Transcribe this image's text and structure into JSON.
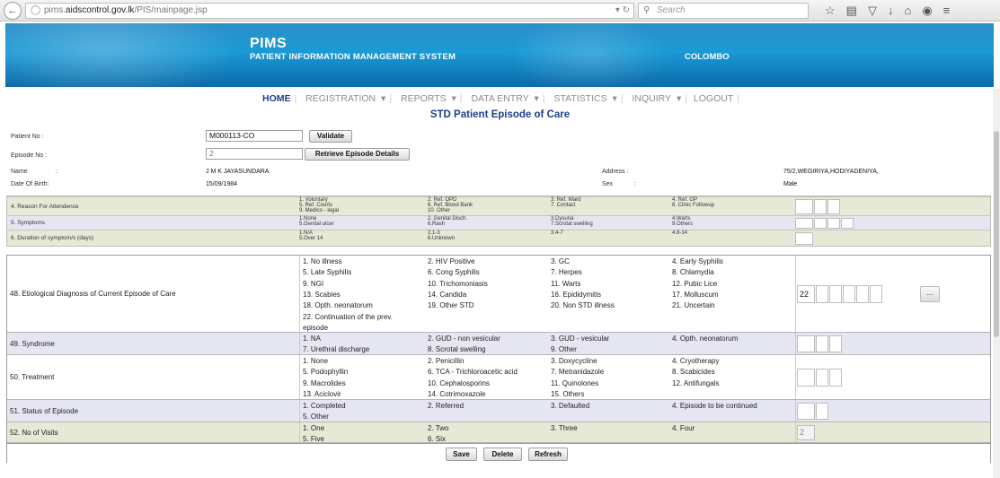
{
  "browser": {
    "url_prefix": "pims.",
    "url_domain": "aidscontrol.gov.lk",
    "url_path": "/PIS/mainpage.jsp",
    "search_placeholder": "Search"
  },
  "header": {
    "app": "PIMS",
    "subtitle": "PATIENT INFORMATION MANAGEMENT SYSTEM",
    "location": "COLOMBO"
  },
  "nav": [
    "HOME",
    "REGISTRATION",
    "REPORTS",
    "DATA ENTRY",
    "STATISTICS",
    "INQUIRY",
    "LOGOUT"
  ],
  "page_title": "STD Patient Episode of Care",
  "form": {
    "patient_no_label": "Patient No :",
    "patient_no": "M000113-CO",
    "validate": "Validate",
    "episode_no_label": "Episode No :",
    "episode_no": "2",
    "retrieve": "Retrieve Episode Details",
    "name_label": "Name",
    "name_colon": ":",
    "name": "J M K JAYASUNDARA",
    "address_label": "Address :",
    "address": "75/2,WEGIRIYA,HODIYADENIYA,",
    "dob_label": "Date Of Birth:",
    "dob": "15/09/1984",
    "sex_label": "Sex",
    "sex_colon": ":",
    "sex": "Male"
  },
  "sec1": [
    {
      "label": "4. Reason For Attendence",
      "opts": [
        "1. Voluntary",
        "2. Ref. OPD",
        "3. Ref. Ward",
        "4. Ref. GP",
        "5. Ref. Courts",
        "6. Ref. Blood Bank",
        "7. Contact",
        "8. Clinic Followup",
        "9. Medico - legal",
        "10. Other"
      ],
      "cols": 4,
      "boxes": 3
    },
    {
      "label": "5. Symptoms",
      "opts": [
        "1.None",
        "2. Genital Disch.",
        "3.Dysuria",
        "4.Warts",
        "5.Genital ulcer",
        "6.Rash",
        "7.Scrotal swelling",
        "9.Others"
      ],
      "cols": 4,
      "boxes": 4
    },
    {
      "label": "6. Duration of symptom/s (days)",
      "opts": [
        "1.N/A",
        "2.1-3",
        "3.4-7",
        "4.8-14",
        "5.Over 14",
        "6.Unknown"
      ],
      "cols": 4,
      "boxes": 1
    }
  ],
  "sec2": [
    {
      "label": "48. Etiological Diagnosis of Current Episode of Care",
      "opts": [
        "1. No illness",
        "2. HIV Positive",
        "3. GC",
        "4. Early Syphilis",
        "5. Late Syphilis",
        "6. Cong Syphilis",
        "7. Herpes",
        "8. Chlamydia",
        "9. NGI",
        "10. Trichomoniasis",
        "11. Warts",
        "12. Pubic Lice",
        "13. Scabies",
        "14. Candida",
        "16. Epididymitis",
        "17. Molluscum",
        "18. Opth. neonatorum",
        "19. Other STD",
        "20. Non STD illness",
        "21. Uncertain",
        "22. Continuation of the prev.",
        "",
        "",
        "",
        "episode",
        "",
        "",
        ""
      ],
      "value": "22",
      "boxes": 6
    },
    {
      "label": "49. Syndrome",
      "opts": [
        "1. NA",
        "2. GUD - non vesicular",
        "3. GUD - vesicular",
        "4. Opth. neonatorum",
        "7. Urethral discharge",
        "8. Scrotal swelling",
        "9. Other",
        ""
      ],
      "boxes": 3
    },
    {
      "label": "50. Treatment",
      "opts": [
        "1. None",
        "2. Penicillin",
        "3. Doxycycline",
        "4. Cryotherapy",
        "5. Podophyllin",
        "6. TCA - Trichloroacetic acid",
        "7. Metranidazole",
        "8. Scabicides",
        "9. Macrolides",
        "10. Cephalosporins",
        "11. Quinolones",
        "12. Antifungals",
        "13. Aciclovir",
        "14. Cotrimoxazole",
        "15. Others",
        ""
      ],
      "boxes": 3
    },
    {
      "label": "51. Status of Episode",
      "opts": [
        "1. Completed",
        "2. Referred",
        "3. Defaulted",
        "4. Episode to be continued",
        "5. Other",
        "",
        "",
        ""
      ],
      "boxes": 2
    },
    {
      "label": "52. No of Visits",
      "opts": [
        "1. One",
        "2. Two",
        "3. Three",
        "4. Four",
        "5. Five",
        "6. Six",
        "",
        ""
      ],
      "value": "2",
      "boxes": 1
    }
  ],
  "buttons": {
    "save": "Save",
    "delete": "Delete",
    "refresh": "Refresh",
    "more": "..."
  }
}
